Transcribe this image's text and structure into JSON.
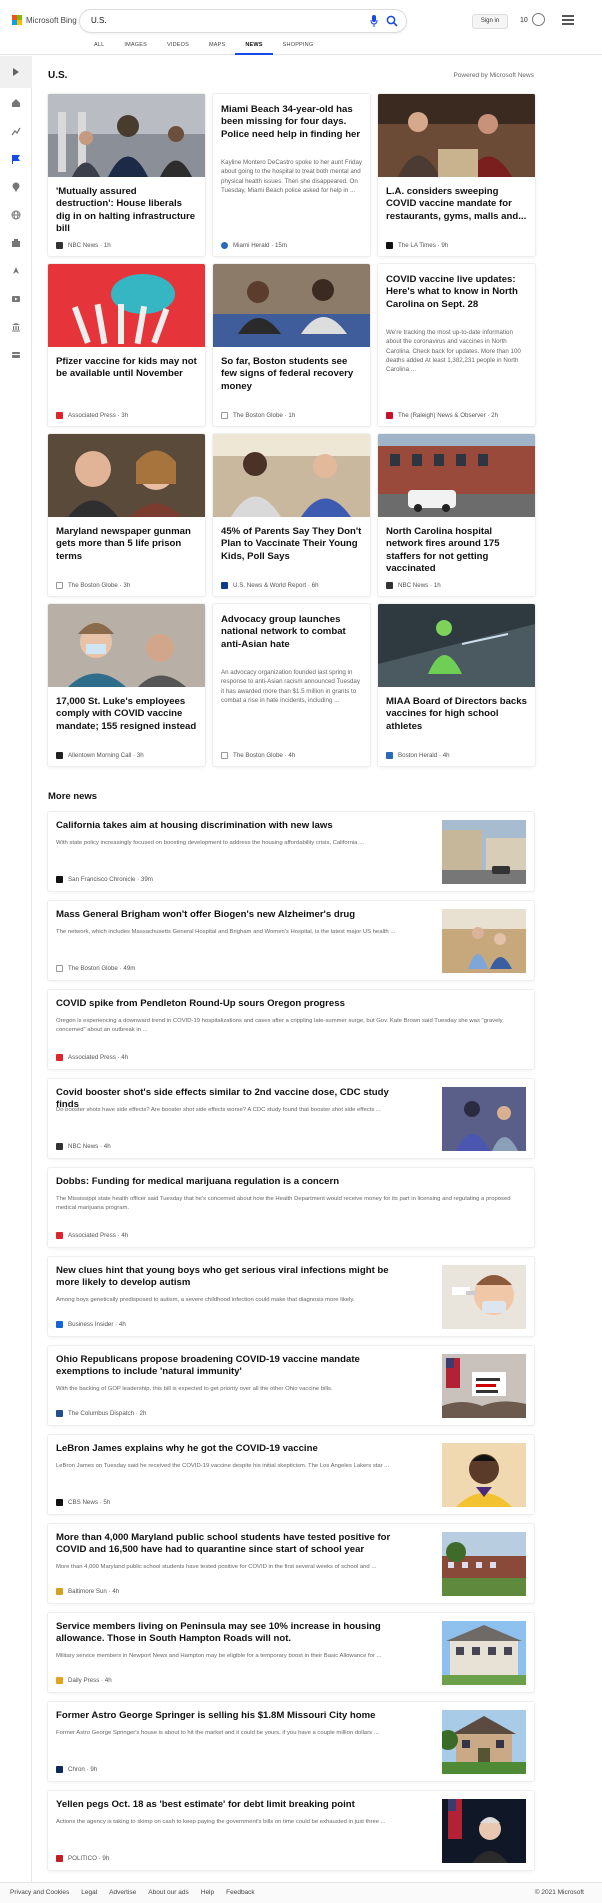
{
  "header": {
    "brand": "Microsoft Bing",
    "query": "U.S.",
    "signin": "Sign in",
    "points": "10"
  },
  "tabs": [
    "ALL",
    "IMAGES",
    "VIDEOS",
    "MAPS",
    "NEWS",
    "SHOPPING"
  ],
  "section": {
    "title": "U.S.",
    "powered": "Powered by Microsoft News"
  },
  "cards": [
    {
      "title": "'Mutually assured destruction': House liberals dig in on halting infrastructure bill",
      "desc": "",
      "source": "NBC News · 1h"
    },
    {
      "title": "Miami Beach 34-year-old has been missing for four days. Police need help in finding her",
      "desc": "Kayline Montero DeCastro spoke to her aunt Friday about going to the hospital to treat both mental and physical health issues. Then she disappeared. On Tuesday, Miami Beach police asked for help in ...",
      "source": "Miami Herald · 15m"
    },
    {
      "title": "L.A. considers sweeping COVID vaccine mandate for restaurants, gyms, malls and...",
      "desc": "",
      "source": "The LA Times · 9h"
    },
    {
      "title": "Pfizer vaccine for kids may not be available until November",
      "desc": "",
      "source": "Associated Press · 3h"
    },
    {
      "title": "So far, Boston students see few signs of federal recovery money",
      "desc": "",
      "source": "The Boston Globe · 1h"
    },
    {
      "title": "COVID vaccine live updates: Here's what to know in North Carolina on Sept. 28",
      "desc": "We're tracking the most up-to-date information about the coronavirus and vaccines in North Carolina. Check back for updates. More than 100 deaths added At least 1,382,231 people in North Carolina ...",
      "source": "The (Raleigh) News & Observer · 2h"
    },
    {
      "title": "Maryland newspaper gunman gets more than 5 life prison terms",
      "desc": "",
      "source": "The Boston Globe · 3h"
    },
    {
      "title": "45% of Parents Say They Don't Plan to Vaccinate Their Young Kids, Poll Says",
      "desc": "",
      "source": "U.S. News & World Report · 6h"
    },
    {
      "title": "North Carolina hospital network fires around 175 staffers for not getting vaccinated",
      "desc": "",
      "source": "NBC News · 1h"
    },
    {
      "title": "17,000 St. Luke's employees comply with COVID vaccine mandate; 155 resigned instead",
      "desc": "",
      "source": "Allentown Morning Call · 3h"
    },
    {
      "title": "Advocacy group launches national network to combat anti-Asian hate",
      "desc": "An advocacy organization founded last spring in response to anti-Asian racism announced Tuesday it has awarded more than $1.5 million in grants to combat a rise in hate incidents, including ...",
      "source": "The Boston Globe · 4h"
    },
    {
      "title": "MIAA Board of Directors backs vaccines for high school athletes",
      "desc": "",
      "source": "Boston Herald · 4h"
    }
  ],
  "more": {
    "title": "More news",
    "items": [
      {
        "title": "California takes aim at housing discrimination with new laws",
        "desc": "With state policy increasingly focused on boosting development to address the housing affordability crisis, California ...",
        "source": "San Francisco Chronicle · 39m"
      },
      {
        "title": "Mass General Brigham won't offer Biogen's new Alzheimer's drug",
        "desc": "The network, which includes Massachusetts General Hospital and Brigham and Women's Hospital, is the latest major US health ...",
        "source": "The Boston Globe · 49m"
      },
      {
        "title": "COVID spike from Pendleton Round-Up sours Oregon progress",
        "desc": "Oregon is experiencing a downward trend in COVID-19 hospitalizations and cases after a crippling late-summer surge, but Gov. Kate Brown said Tuesday she was \"gravely concerned\" about an outbreak in ...",
        "source": "Associated Press · 4h"
      },
      {
        "title": "Covid booster shot's side effects similar to 2nd vaccine dose, CDC study finds",
        "desc": "Do booster shots have side effects? Are booster shot side effects worse? A CDC study found that booster shot side effects ...",
        "source": "NBC News · 4h"
      },
      {
        "title": "Dobbs: Funding for medical marijuana regulation is a concern",
        "desc": "The Mississippi state health officer said Tuesday that he's concerned about how the Health Department would receive money for its part in licensing and regulating a proposed medical marijuana program.",
        "source": "Associated Press · 4h"
      },
      {
        "title": "New clues hint that young boys who get serious viral infections might be more likely to develop autism",
        "desc": "Among boys genetically predisposed to autism, a severe childhood infection could make that diagnosis more likely.",
        "source": "Business Insider · 4h"
      },
      {
        "title": "Ohio Republicans propose broadening COVID-19 vaccine mandate exemptions to include 'natural immunity'",
        "desc": "With the backing of GOP leadership, this bill is expected to get priority over all the other Ohio vaccine bills.",
        "source": "The Columbus Dispatch · 2h"
      },
      {
        "title": "LeBron James explains why he got the COVID-19 vaccine",
        "desc": "LeBron James on Tuesday said he received the COVID-19 vaccine despite his initial skepticism. The Los Angeles Lakers star ...",
        "source": "CBS News · 5h"
      },
      {
        "title": "More than 4,000 Maryland public school students have tested positive for COVID and 16,500 have had to quarantine since start of school year",
        "desc": "More than 4,000 Maryland public school students have tested positive for COVID in the first several weeks of school and ...",
        "source": "Baltimore Sun · 4h"
      },
      {
        "title": "Service members living on Peninsula may see 10% increase in housing allowance. Those in South Hampton Roads will not.",
        "desc": "Military service members in Newport News and Hampton may be eligible for a temporary boost in their Basic Allowance for ...",
        "source": "Daily Press · 4h"
      },
      {
        "title": "Former Astro George Springer is selling his $1.8M Missouri City home",
        "desc": "Former Astro George Springer's house is about to hit the market and it could be yours, if you have a couple million dollars ...",
        "source": "Chron · 9h"
      },
      {
        "title": "Yellen pegs Oct. 18 as 'best estimate' for debt limit breaking point",
        "desc": "Actions the agency is taking to skimp on cash to keep paying the government's bills on time could be exhausted in just three ...",
        "source": "POLITICO · 9h"
      }
    ]
  },
  "footer": {
    "links": [
      "Privacy and Cookies",
      "Legal",
      "Advertise",
      "About our ads",
      "Help",
      "Feedback"
    ],
    "copyright": "© 2021 Microsoft"
  },
  "colors": {
    "accent": "#174ae4",
    "nbc": "#333",
    "ap": "#e0242b",
    "herald": "#2a6ab8"
  }
}
